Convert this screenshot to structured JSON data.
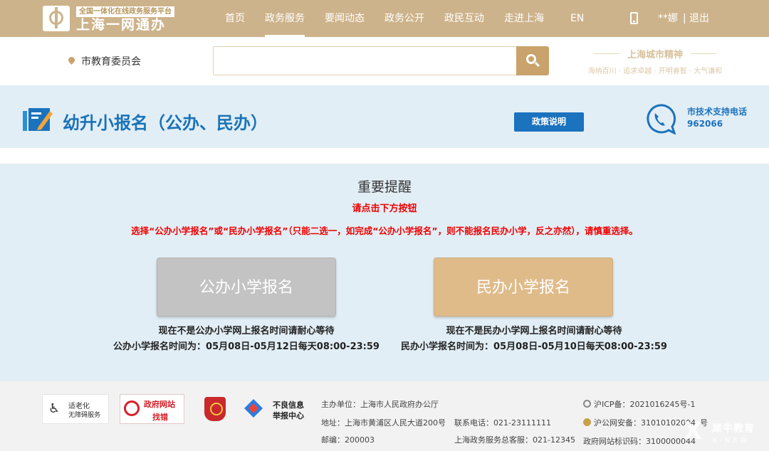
{
  "header": {
    "logo_tag": "全国一体化在线政务服务平台",
    "logo_name": "上海一网通办",
    "nav": [
      "首页",
      "政务服务",
      "要闻动态",
      "政务公开",
      "政民互动",
      "走进上海",
      "EN"
    ],
    "active_nav": "政务服务",
    "user": "**娜",
    "separator": "|",
    "logout": "退出"
  },
  "searchbar": {
    "location": "市教育委员会",
    "query": "",
    "spirit_title": "上海城市精神",
    "spirit_sub": "海纳百川 · 追求卓越 · 开明睿智 · 大气谦和"
  },
  "service": {
    "title": "幼升小报名（公办、民办）",
    "policy_button": "政策说明",
    "support_label": "市技术支持电话",
    "support_phone": "962066"
  },
  "notice": {
    "title": "重要提醒",
    "red1": "请点击下方按钮",
    "red2": "选择“公办小学报名”或“民办小学报名”（只能二选一，如完成“公办小学报名”，则不能报名民办小学，反之亦然），请慎重选择。",
    "public_button": "公办小学报名",
    "private_button": "民办小学报名",
    "public_hint1": "现在不是公办小学网上报名时间请耐心等待",
    "public_hint2": "公办小学报名时间为：05月08日-05月12日每天08:00-23:59",
    "private_hint1": "现在不是民办小学网上报名时间请耐心等待",
    "private_hint2": "民办小学报名时间为：05月08日-05月10日每天08:00-23:59"
  },
  "footer": {
    "accessibility_1": "适老化",
    "accessibility_2": "无障碍服务",
    "gov_site_1": "政府网站",
    "gov_site_2": "找错",
    "report_1": "不良信息",
    "report_2": "举报中心",
    "host": "主办单位：上海市人民政府办公厅",
    "address": "地址：上海市黄浦区人民大道200号",
    "postcode": "邮编：200003",
    "contact": "联系电话：021-23111111",
    "service_line": "上海政务服务总客服：021-12345",
    "icp": "沪ICP备：2021016245号-1",
    "police": "沪公网安备：31010102004",
    "police_tail": "号",
    "site_code": "政府网站标识码：3100000044"
  },
  "watermark": {
    "mark": "X",
    "line1": "犀牛教育",
    "line2": "X-NEW"
  },
  "colors": {
    "brand_gold": "#cdb38b",
    "accent_blue": "#1b72bd",
    "alert_red": "#ee0000",
    "public_button_bg": "#c3c3c3",
    "private_button_bg": "#e0bb8a"
  },
  "icons": [
    "logo-icon",
    "phone-icon",
    "location-pin-icon",
    "search-icon",
    "edit-form-icon",
    "support-phone-icon",
    "wheelchair-icon",
    "magnifier-icon",
    "police-emblem-icon",
    "report-icon",
    "icp-icon",
    "police-badge-icon"
  ]
}
